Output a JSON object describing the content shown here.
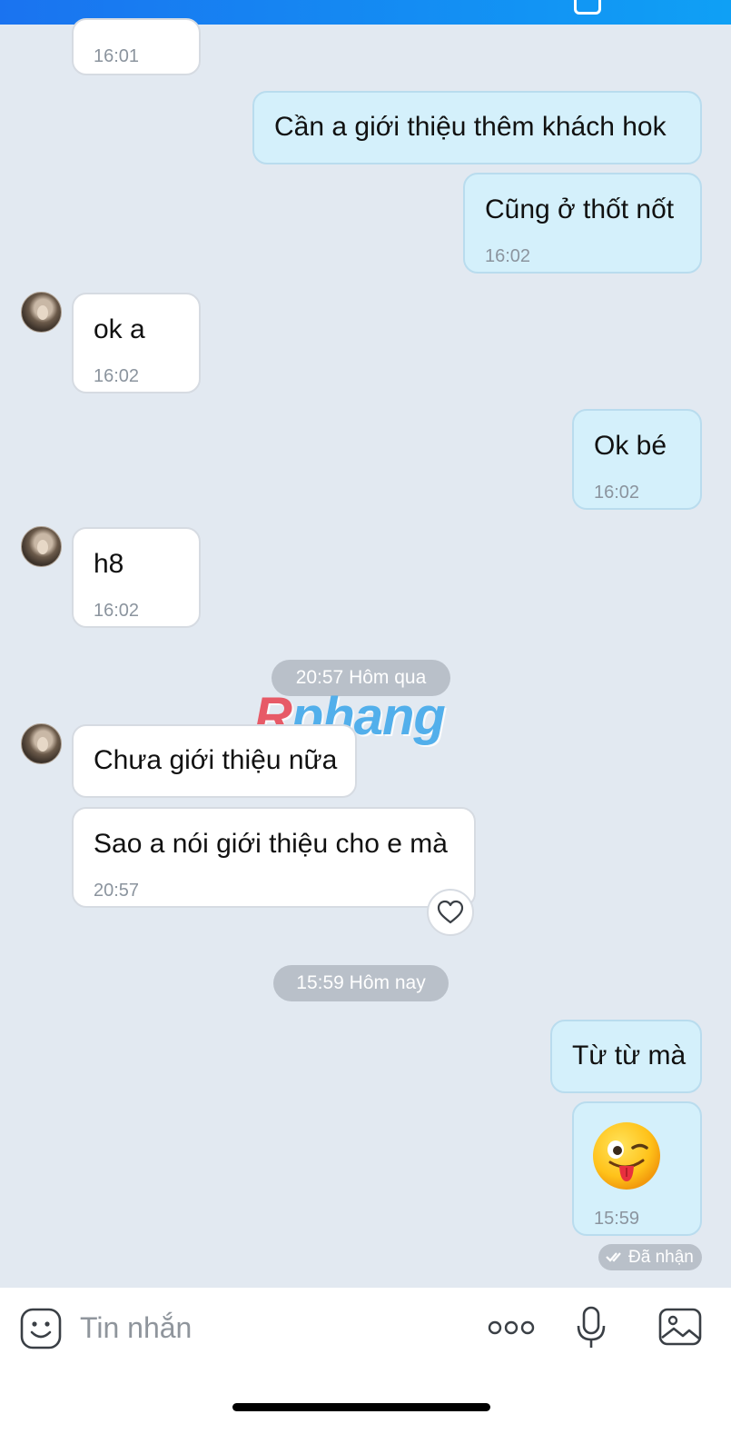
{
  "messages": [
    {
      "side": "in",
      "time": "16:01"
    },
    {
      "side": "out",
      "text": "Cần a giới thiệu thêm khách hok"
    },
    {
      "side": "out",
      "text": "Cũng ở thốt nốt",
      "time": "16:02"
    },
    {
      "side": "in",
      "text": "ok a",
      "time": "16:02"
    },
    {
      "side": "out",
      "text": "Ok bé",
      "time": "16:02"
    },
    {
      "side": "in",
      "text": "h8",
      "time": "16:02"
    },
    {
      "side": "in",
      "text": "Chưa giới thiệu nữa"
    },
    {
      "side": "in",
      "text": "Sao a nói giới thiệu cho e mà",
      "time": "20:57"
    },
    {
      "side": "out",
      "text": "Từ từ mà"
    },
    {
      "side": "out",
      "sticker": "wink-tongue-emoji",
      "time": "15:59"
    }
  ],
  "dividers": [
    "20:57 Hôm qua",
    "15:59 Hôm nay"
  ],
  "watermark": {
    "r": "R",
    "rest": "phang"
  },
  "status": "Đã nhận",
  "input": {
    "placeholder": "Tin nhắn"
  },
  "colors": {
    "header": "#1a73f0",
    "incoming": "#ffffff",
    "outgoing": "#d4f0fb",
    "background": "#e2e9f1"
  }
}
